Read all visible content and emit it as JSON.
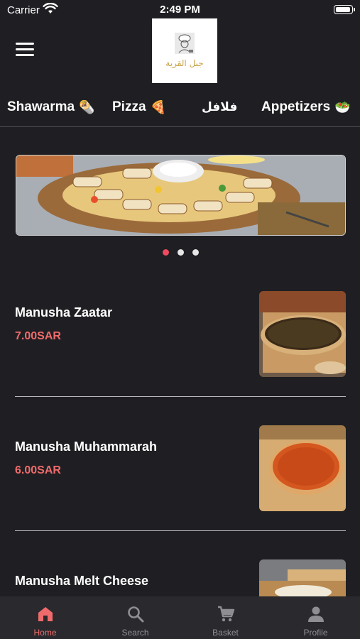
{
  "status_bar": {
    "carrier": "Carrier",
    "time": "2:49 PM",
    "battery_level": 1.0
  },
  "header": {
    "logo_text": "جبل القرية"
  },
  "categories": [
    {
      "label": "Shawarma",
      "emoji": "🌯"
    },
    {
      "label": "Pizza",
      "emoji": "🍕"
    },
    {
      "label": "فلافل"
    },
    {
      "label": "Appetizers",
      "emoji": "🥗"
    }
  ],
  "banner": {
    "slide_count": 3,
    "active_slide": 1
  },
  "products": [
    {
      "name": "Manusha Zaatar",
      "price": "7.00SAR"
    },
    {
      "name": "Manusha Muhammarah",
      "price": "6.00SAR"
    },
    {
      "name": "Manusha Melt Cheese"
    }
  ],
  "tab_bar": {
    "items": [
      {
        "label": "Home",
        "icon": "home-icon",
        "active": true
      },
      {
        "label": "Search",
        "icon": "search-icon"
      },
      {
        "label": "Basket",
        "icon": "cart-icon"
      },
      {
        "label": "Profile",
        "icon": "person-icon"
      }
    ]
  },
  "colors": {
    "background": "#1f1f23",
    "accent": "#ef6b6b",
    "tab_bar": "#2a2a2e"
  }
}
